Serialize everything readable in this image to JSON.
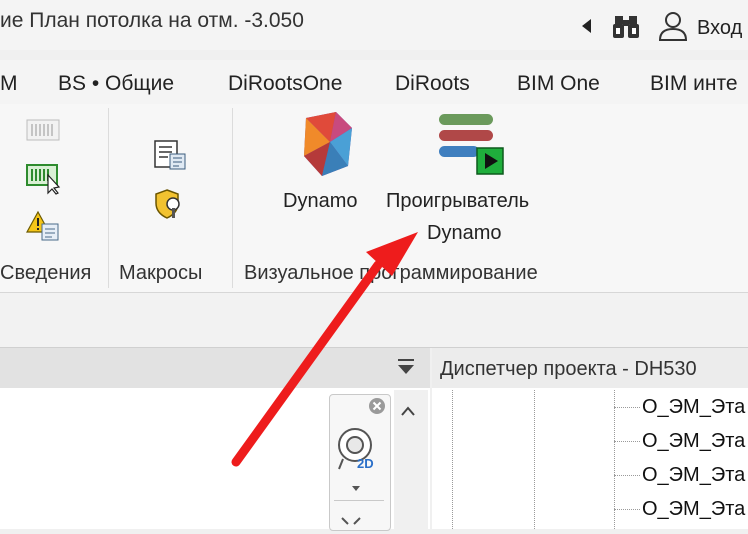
{
  "titlebar": {
    "title": "ие План потолка на отм. -3.050",
    "signin_label": "Вход"
  },
  "tabs": [
    "М",
    "BS • Общие",
    "DiRootsOne",
    "DiRoots",
    "BIM One",
    "BIM инте"
  ],
  "ribbon": {
    "panels": {
      "info_label": "Сведения",
      "macros_label": "Макросы",
      "visual_label": "Визуальное программирование"
    },
    "dynamo_label": "Dynamo",
    "player_label_line1": "Проигрыватель",
    "player_label_line2": "Dynamo"
  },
  "nav_bar": {
    "badge_2d": "2D"
  },
  "browser": {
    "title": "Диспетчер проекта - DH530",
    "items": [
      "О_ЭМ_Эта",
      "О_ЭМ_Эта",
      "О_ЭМ_Эта",
      "О_ЭМ_Эта"
    ]
  },
  "colors": {
    "annotation_arrow": "#ee1c1c",
    "play_green": "#1fae3c"
  }
}
